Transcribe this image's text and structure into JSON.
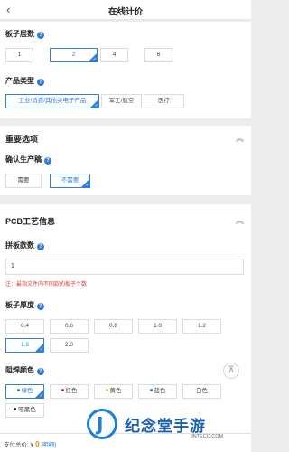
{
  "header": {
    "title": "在线计价",
    "back_icon": "‹"
  },
  "layers": {
    "label": "板子层数",
    "options": [
      "1",
      "2",
      "4",
      "6"
    ],
    "selected": "2"
  },
  "product_type": {
    "label": "产品类型",
    "options": [
      "工业/消费/其他类电子产品",
      "军工/航空",
      "医疗"
    ],
    "selected": "工业/消费/其他类电子产品"
  },
  "important": {
    "title": "重要选项",
    "confirm": {
      "label": "确认生产稿",
      "options": [
        "需要",
        "不需要"
      ],
      "selected": "不需要"
    }
  },
  "pcb": {
    "title": "PCB工艺信息",
    "panel_count": {
      "label": "拼板款数",
      "value": "1",
      "note": "注：最指文件内不同款的板子个数"
    },
    "thickness": {
      "label": "板子厚度",
      "options": [
        "0.4",
        "0.6",
        "0.8",
        "1.0",
        "1.2",
        "1.6",
        "2.0"
      ],
      "selected": "1.6"
    },
    "solder_mask": {
      "label": "阻焊颜色",
      "options": [
        {
          "label": "绿色",
          "color": "#2f9a3a"
        },
        {
          "label": "红色",
          "color": "#e02a2a"
        },
        {
          "label": "黄色",
          "color": "#f0c419"
        },
        {
          "label": "蓝色",
          "color": "#2f7fd8"
        },
        {
          "label": "白色",
          "color": ""
        },
        {
          "label": "哑黑色",
          "color": "#222222"
        }
      ],
      "selected": "绿色"
    }
  },
  "footer": {
    "label": "支付总价:",
    "currency": "¥",
    "price": "0",
    "detail": "[明细]"
  },
  "totop_icon": "⊼",
  "watermark": {
    "logo_letter": "J",
    "name": "纪念堂手游",
    "url": "JNTECC.COM"
  },
  "colors": {
    "accent": "#2f7fd8",
    "price": "#f08a00",
    "note": "#e03a3a"
  }
}
